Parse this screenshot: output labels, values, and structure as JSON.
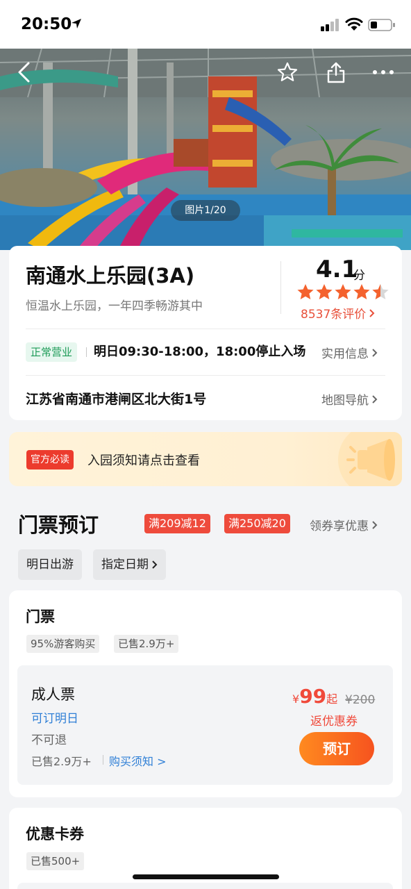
{
  "status_bar": {
    "time": "20:50"
  },
  "hero": {
    "photo_counter": "图片1/20"
  },
  "attraction": {
    "name": "南通水上乐园(3A)",
    "tagline": "恒温水上乐园，一年四季畅游其中",
    "score": "4.1",
    "score_unit": "分",
    "rating_stars": 4.5,
    "review_count": "8537条评价",
    "open_status": "正常营业",
    "hours": "明日09:30-18:00，18:00停止入场",
    "practical_info_label": "实用信息",
    "address": "江苏省南通市港闸区北大街1号",
    "map_nav_label": "地图导航"
  },
  "notice": {
    "tag": "官方必读",
    "text": "入园须知请点击查看"
  },
  "booking": {
    "title": "门票预订",
    "coupons": [
      "满209减12",
      "满250减20"
    ],
    "coupon_link": "领券享优惠",
    "date_options": [
      "明日出游",
      "指定日期"
    ]
  },
  "ticket_section": {
    "title": "门票",
    "chips": [
      "95%游客购买",
      "已售2.9万+"
    ],
    "item": {
      "name": "成人票",
      "availability": "可订明日",
      "refund": "不可退",
      "sold": "已售2.9万+",
      "purchase_notice": "购买须知 >",
      "currency": "¥",
      "price": "99",
      "price_suffix": "起",
      "original_price": "¥200",
      "rebate": "返优惠券",
      "book_label": "预订"
    }
  },
  "card_section": {
    "title": "优惠卡券",
    "chip": "已售500+"
  },
  "colors": {
    "accent_red": "#f0493a",
    "link_blue": "#2f7fd6",
    "open_green": "#1d9b57",
    "book_orange": "#ff8a1f"
  }
}
